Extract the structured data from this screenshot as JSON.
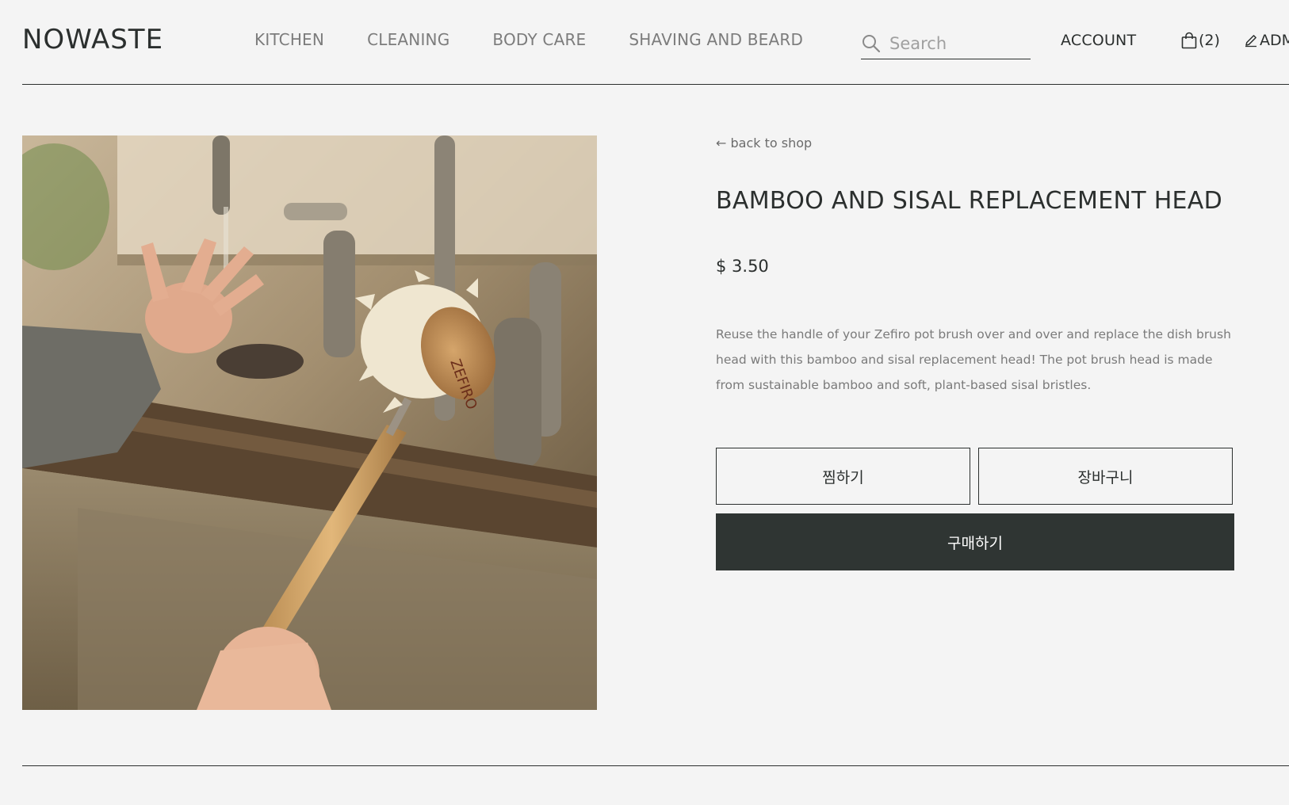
{
  "header": {
    "logo": "NOWASTE",
    "nav": [
      "KITCHEN",
      "CLEANING",
      "BODY CARE",
      "SHAVING AND BEARD"
    ],
    "search_placeholder": "Search",
    "account_label": "ACCOUNT",
    "cart_count": "(2)",
    "admin_label": "ADMIN"
  },
  "product": {
    "back_link": "← back to shop",
    "title": "BAMBOO AND SISAL REPLACEMENT HEAD",
    "price": "$ 3.50",
    "description": "Reuse the handle of your Zefiro pot brush over and over and replace the dish brush head with this bamboo and sisal replacement head! The pot brush head is made from sustainable bamboo and soft, plant-based sisal bristles.",
    "brand_on_image": "ZEFIRO"
  },
  "actions": {
    "wishlist_label": "찜하기",
    "cart_label": "장바구니",
    "buy_label": "구매하기"
  },
  "colors": {
    "background": "#f4f4f4",
    "text": "#2b2f2e",
    "muted": "#7a7a7a",
    "buy_button": "#2f3533"
  },
  "icons": {
    "search": "search-icon",
    "cart": "shopping-bag-icon",
    "admin": "pencil-icon"
  }
}
